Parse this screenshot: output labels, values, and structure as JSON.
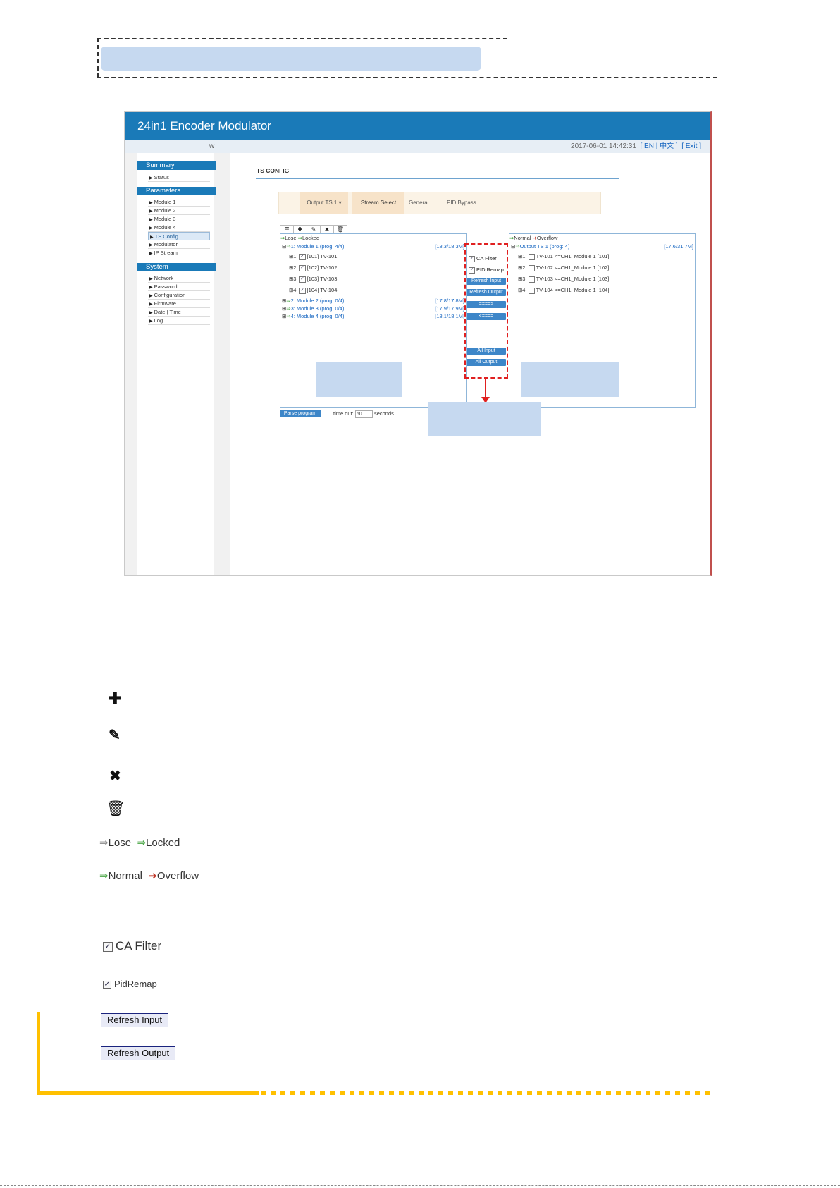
{
  "app": {
    "title": "24in1 Encoder Modulator",
    "sub_left": "w",
    "datetime": "2017-06-01 14:42:31",
    "lang_links": "[ EN | 中文 ]",
    "exit_link": "[ Exit ]"
  },
  "sidebar": {
    "summary": {
      "heading": "Summary",
      "items": [
        "Status"
      ]
    },
    "parameters": {
      "heading": "Parameters",
      "items": [
        "Module 1",
        "Module 2",
        "Module 3",
        "Module 4",
        "TS Config",
        "Modulator",
        "IP Stream"
      ]
    },
    "system": {
      "heading": "System",
      "items": [
        "Network",
        "Password",
        "Configuration",
        "Firmware",
        "Date | Time",
        "Log"
      ]
    }
  },
  "main": {
    "title": "TS CONFIG",
    "tabs": {
      "output": "Output TS 1 ▾",
      "stream_select": "Stream Select",
      "general": "General",
      "pid_bypass": "PID Bypass"
    },
    "toolbar": {
      "list": "☰",
      "add": "✚",
      "edit": "✎",
      "delete": "✖",
      "trash": "🗑"
    }
  },
  "left_panel": {
    "legend_lose": "Lose",
    "legend_locked": "Locked",
    "module1": {
      "label": "1: Module 1 (prog: 4/4)",
      "rate": "[18.3/18.3M]"
    },
    "programs": [
      {
        "idx": "1:",
        "label": "[101] TV-101"
      },
      {
        "idx": "2:",
        "label": "[102] TV-102"
      },
      {
        "idx": "3:",
        "label": "[103] TV-103"
      },
      {
        "idx": "4:",
        "label": "[104] TV-104"
      }
    ],
    "modules": [
      {
        "label": "2: Module 2 (prog: 0/4)",
        "rate": "[17.8/17.8M]"
      },
      {
        "label": "3: Module 3 (prog: 0/4)",
        "rate": "[17.9/17.9M]"
      },
      {
        "label": "4: Module 4 (prog: 0/4)",
        "rate": "[18.1/18.1M]"
      }
    ]
  },
  "right_panel": {
    "legend_normal": "Normal",
    "legend_overflow": "Overflow",
    "output": {
      "label": "Output TS 1 (prog: 4)",
      "rate": "[17.6/31.7M]"
    },
    "programs": [
      {
        "idx": "1:",
        "label": "TV-101 <=CH1_Module 1 [101]"
      },
      {
        "idx": "2:",
        "label": "TV-102 <=CH1_Module 1 [102]"
      },
      {
        "idx": "3:",
        "label": "TV-103 <=CH1_Module 1 [103]"
      },
      {
        "idx": "4:",
        "label": "TV-104 <=CH1_Module 1 [104]"
      }
    ]
  },
  "middle": {
    "ca_filter": "CA Filter",
    "pid_remap": "PID Remap",
    "refresh_input": "Refresh Input",
    "refresh_output": "Refresh Output",
    "to_right": "====>",
    "to_left": "<====",
    "all_input": "All Input",
    "all_output": "All Output"
  },
  "bottom": {
    "parse_program": "Parse program",
    "timeout_label": "time out:",
    "timeout_value": "60",
    "seconds": "seconds"
  },
  "legend": {
    "add_icon": "plus-icon",
    "edit_icon": "pencil-icon",
    "delete_icon": "x-icon",
    "trash_icon": "trash-icon",
    "lose": "Lose",
    "locked": "Locked",
    "normal": "Normal",
    "overflow": "Overflow",
    "ca_filter": "CA Filter",
    "pid_remap": "PidRemap",
    "refresh_input": "Refresh Input",
    "refresh_output": "Refresh Output"
  },
  "colors": {
    "brand_blue": "#1a7ab8",
    "button_blue": "#3d86c8",
    "highlight_box": "#c6d9f0",
    "red_dash": "#e02020",
    "yellow_frame": "#ffc000"
  }
}
